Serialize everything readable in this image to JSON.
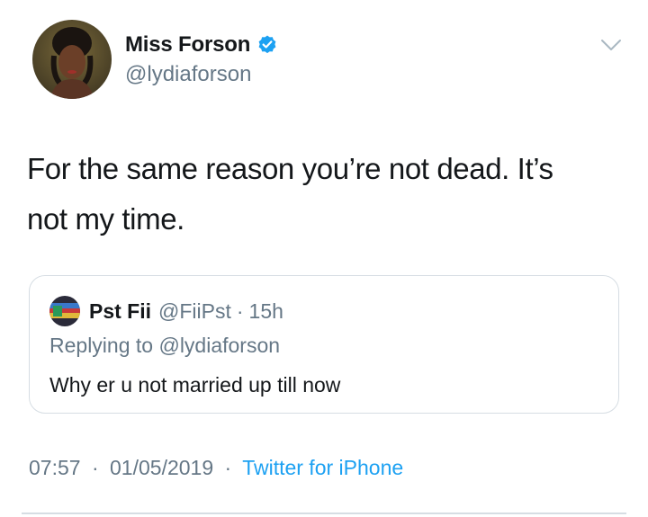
{
  "tweet": {
    "author": {
      "display_name": "Miss Forson",
      "handle": "@lydiaforson",
      "verified_icon": "verified-badge-icon",
      "avatar": "avatar-photo"
    },
    "menu_icon": "chevron-down-icon",
    "text_line1": "For the same reason you’re not dead. It’s",
    "text_line2": "not my time.",
    "quoted": {
      "display_name": "Pst Fii",
      "handle": "@FiiPst",
      "separator": "·",
      "time": "15h",
      "replying_to_prefix": "Replying to",
      "replying_to_handle": "@lydiaforson",
      "text": "Why er u not married up till now"
    },
    "meta": {
      "time": "07:57",
      "separator": "·",
      "date": "01/05/2019",
      "source": "Twitter for iPhone"
    }
  },
  "colors": {
    "text": "#14171a",
    "secondary": "#657786",
    "link": "#1da1f2",
    "border": "#d6dde3"
  }
}
